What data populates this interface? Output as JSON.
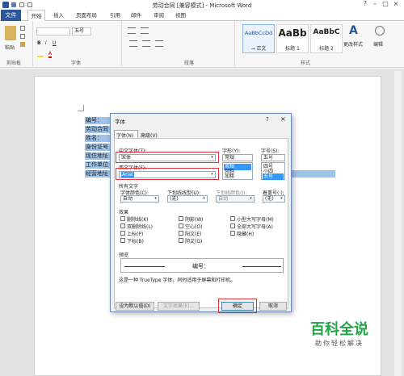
{
  "window": {
    "title": "劳动合同 [兼容模式] - Microsoft Word"
  },
  "tabs": {
    "file": "文件",
    "home": "开始",
    "insert": "插入",
    "layout": "页面布局",
    "refs": "引用",
    "mail": "邮件",
    "review": "审阅",
    "view": "视图"
  },
  "ribbon": {
    "clipboard_label": "剪贴板",
    "paste_label": "粘贴",
    "font_size": "五号",
    "font_group": "字体",
    "para_group": "段落",
    "styles_group": "样式",
    "edit_label": "编辑",
    "change_styles": "更改样式",
    "styles": [
      {
        "sample": "AaBbCcDd",
        "name": "→ 正文"
      },
      {
        "sample": "AaBb",
        "name": "标题 1"
      },
      {
        "sample": "AaBbC",
        "name": "标题 2"
      }
    ]
  },
  "doc": {
    "lines": [
      "编号：",
      "劳动合同",
      "姓名：",
      "身份证号",
      "现住地址",
      "工作单位",
      "经营地址"
    ]
  },
  "dialog": {
    "title": "字体",
    "help": "?",
    "close": "×",
    "tab_font": "字体(N)",
    "tab_adv": "高级(V)",
    "cn_font_label": "中文字体(T):",
    "cn_font": "宋体",
    "west_font_label": "西文字体(F):",
    "west_font": "Arial",
    "style_label": "字形(Y):",
    "style_value": "常规",
    "style_options": [
      "常规",
      "倾斜",
      "加粗"
    ],
    "size_label": "字号(S):",
    "size_value": "五号",
    "size_options": [
      "四号",
      "小四",
      "五号"
    ],
    "all_text": "所有文字",
    "color_label": "字体颜色(C):",
    "color_value": "自动",
    "underline_label": "下划线线型(U):",
    "underline_value": "(无)",
    "ul_color_label": "下划线颜色(I):",
    "ul_color_value": "自动",
    "emph_label": "着重号(·);",
    "emph_value": "(无)",
    "effects": "效果",
    "fx": [
      "删除线(K)",
      "双删除线(L)",
      "上标(P)",
      "下标(B)",
      "阴影(W)",
      "空心(O)",
      "阳文(E)",
      "阴文(G)",
      "小型大写字母(M)",
      "全部大写字母(A)",
      "隐藏(H)"
    ],
    "preview_label": "预览",
    "preview_text": "编号：",
    "truetype_note": "这是一种 TrueType 字体，同时适用于屏幕和打印机。",
    "default_btn": "设为默认值(D)",
    "text_effects_btn": "文字效果(E)...",
    "ok": "确定",
    "cancel": "取消"
  },
  "watermark": {
    "brand": "百科全说",
    "tagline": "助你轻松解决"
  }
}
